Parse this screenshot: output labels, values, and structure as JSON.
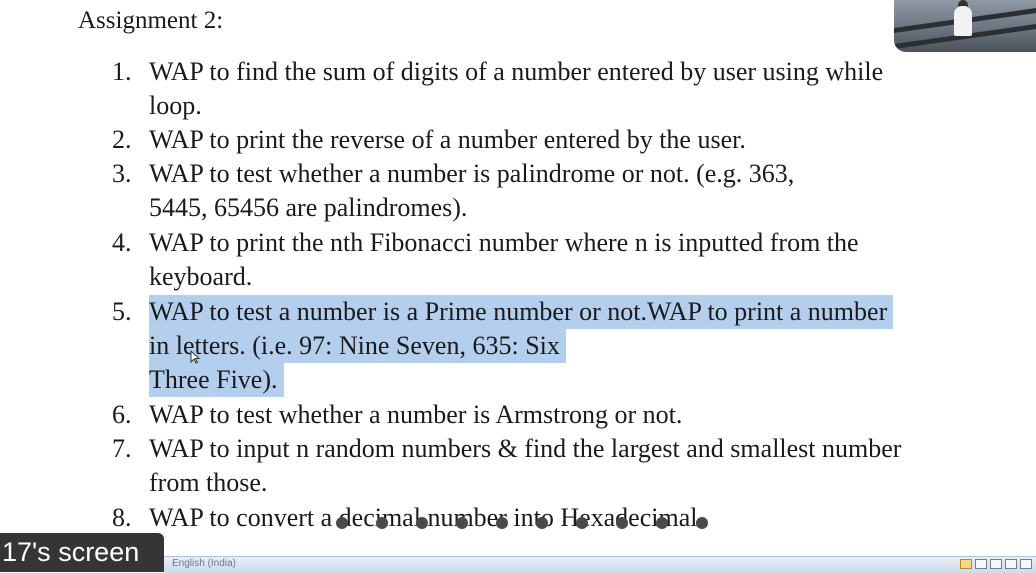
{
  "document": {
    "title": "Assignment 2:",
    "items": [
      {
        "num": "1.",
        "lines": [
          "WAP to find the sum of digits of a number entered by user using while",
          "loop."
        ]
      },
      {
        "num": "2.",
        "lines": [
          "WAP to print the reverse of a number entered by the user."
        ]
      },
      {
        "num": "3.",
        "lines": [
          "WAP to test whether a number is palindrome or not. (e.g. 363,",
          "5445, 65456 are palindromes)."
        ]
      },
      {
        "num": "4.",
        "lines": [
          "WAP to print the nth Fibonacci number where n is inputted from the",
          "keyboard."
        ]
      },
      {
        "num": "5.",
        "lines": [
          "WAP to test a number is a Prime number or not.WAP to print a number",
          "in letters. (i.e. 97: Nine Seven, 635: Six",
          "Three Five)."
        ],
        "selected": true
      },
      {
        "num": "6.",
        "lines": [
          "WAP to test whether a number is Armstrong or not."
        ]
      },
      {
        "num": "7.",
        "lines": [
          "WAP to input n random numbers & find the largest and smallest number",
          "from those."
        ]
      },
      {
        "num": "8.",
        "lines": [
          "WAP to convert a decimal number into Hexadecimal."
        ]
      }
    ]
  },
  "share_label": "17's screen",
  "status_bar": {
    "language": "English (India)"
  },
  "loading_dots": 10,
  "colors": {
    "selection": "#b4cfee",
    "label_bg": "#191919"
  }
}
